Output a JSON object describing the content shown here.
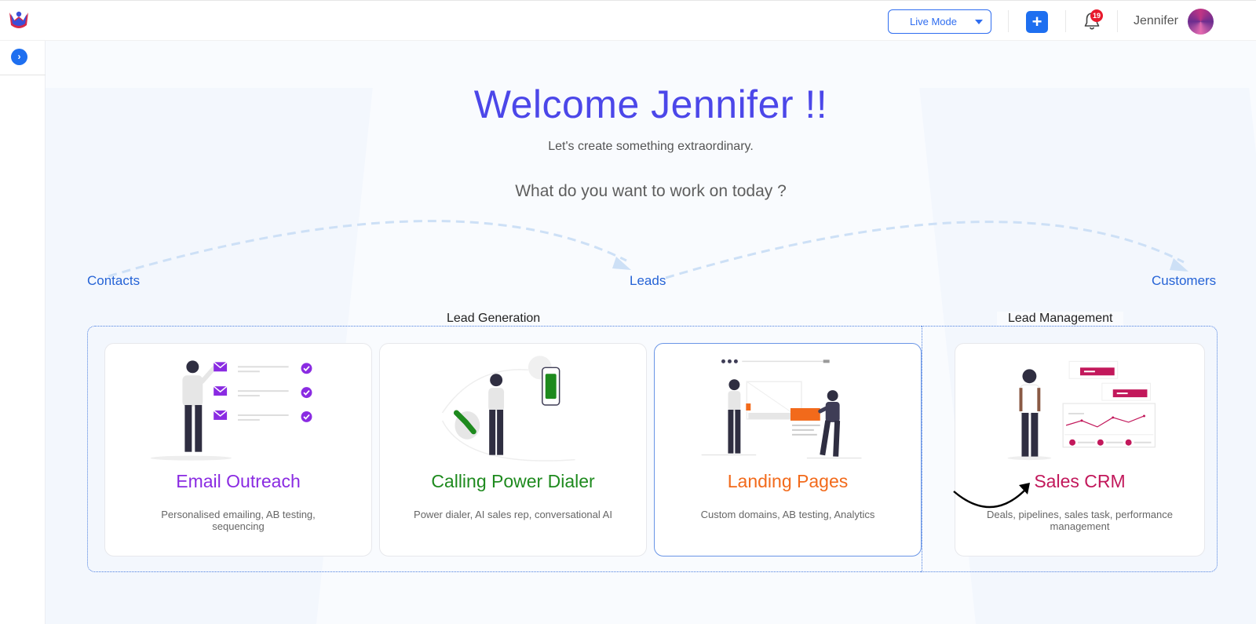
{
  "header": {
    "mode_select": {
      "value": "Live Mode"
    },
    "notifications": {
      "count": "19"
    },
    "user": {
      "name": "Jennifer"
    }
  },
  "hero": {
    "welcome": "Welcome Jennifer !!",
    "subtitle": "Let's create something extraordinary.",
    "question": "What do you want to work on today ?"
  },
  "flow": {
    "stages": [
      "Contacts",
      "Leads",
      "Customers"
    ]
  },
  "groups": {
    "lead_generation": "Lead Generation",
    "lead_management": "Lead Management"
  },
  "cards": [
    {
      "title": "Email Outreach",
      "description": "Personalised emailing, AB testing, sequencing",
      "color": "#8a2be2"
    },
    {
      "title": "Calling Power Dialer",
      "description": "Power dialer, AI sales rep, conversational AI",
      "color": "#1e8a1e"
    },
    {
      "title": "Landing Pages",
      "description": "Custom domains, AB testing, Analytics",
      "color": "#f26a1b"
    },
    {
      "title": "Sales CRM",
      "description": "Deals, pipelines, sales task, performance management",
      "color": "#c2185b"
    }
  ],
  "colors": {
    "primary": "#1e6ff0",
    "welcome": "#4c47e9",
    "stage_link": "#2563d6",
    "badge": "#e8192c"
  }
}
